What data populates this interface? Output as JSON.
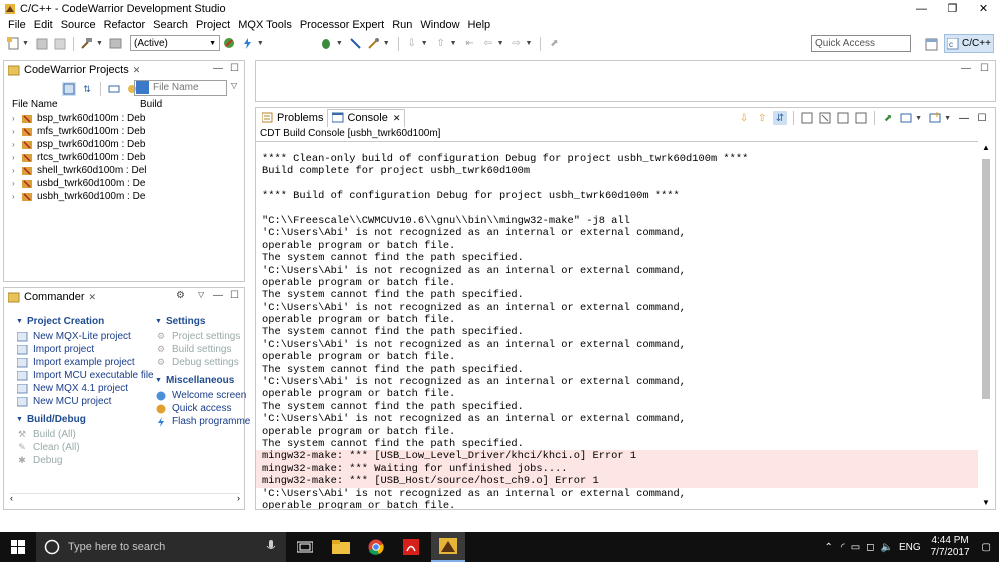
{
  "window": {
    "title": "C/C++ - CodeWarrior Development Studio",
    "minimize_glyph": "—",
    "maximize_glyph": "❐",
    "close_glyph": "✕"
  },
  "menubar": [
    "File",
    "Edit",
    "Source",
    "Refactor",
    "Search",
    "Project",
    "MQX Tools",
    "Processor Expert",
    "Run",
    "Window",
    "Help"
  ],
  "toolbar": {
    "config_value": "(Active)",
    "quick_access_placeholder": "Quick Access",
    "perspective_label": "C/C++"
  },
  "projects_view": {
    "tab_label": "CodeWarrior Projects",
    "filter_placeholder": "File Name",
    "col_file_name": "File Name",
    "col_build": "Build",
    "items": [
      {
        "label": "bsp_twrk60d100m : Deb"
      },
      {
        "label": "mfs_twrk60d100m : Deb"
      },
      {
        "label": "psp_twrk60d100m : Deb"
      },
      {
        "label": "rtcs_twrk60d100m : Deb"
      },
      {
        "label": "shell_twrk60d100m : Del"
      },
      {
        "label": "usbd_twrk60d100m : De"
      },
      {
        "label": "usbh_twrk60d100m : De"
      }
    ]
  },
  "commander": {
    "tab_label": "Commander",
    "project_creation": {
      "header": "Project Creation",
      "items": [
        "New MQX-Lite project",
        "Import project",
        "Import example project",
        "Import MCU executable file",
        "New MQX 4.1 project",
        "New MCU project"
      ]
    },
    "build_debug": {
      "header": "Build/Debug",
      "items": [
        "Build  (All)",
        "Clean  (All)",
        "Debug"
      ]
    },
    "settings": {
      "header": "Settings",
      "items": [
        "Project settings",
        "Build settings",
        "Debug settings"
      ]
    },
    "miscellaneous": {
      "header": "Miscellaneous",
      "items": [
        "Welcome screen",
        "Quick access",
        "Flash programme"
      ]
    }
  },
  "console_view": {
    "tab_problems": "Problems",
    "tab_console": "Console",
    "title": "CDT Build Console [usbh_twrk60d100m]",
    "lines": [
      {
        "text": "**** Clean-only build of configuration Debug for project usbh_twrk60d100m ****",
        "error": false
      },
      {
        "text": "Build complete for project usbh_twrk60d100m",
        "error": false
      },
      {
        "text": "",
        "error": false
      },
      {
        "text": "**** Build of configuration Debug for project usbh_twrk60d100m ****",
        "error": false
      },
      {
        "text": "",
        "error": false
      },
      {
        "text": "\"C:\\\\Freescale\\\\CWMCUv10.6\\\\gnu\\\\bin\\\\mingw32-make\" -j8 all",
        "error": false
      },
      {
        "text": "'C:\\Users\\Abi' is not recognized as an internal or external command,",
        "error": false
      },
      {
        "text": "operable program or batch file.",
        "error": false
      },
      {
        "text": "The system cannot find the path specified.",
        "error": false
      },
      {
        "text": "'C:\\Users\\Abi' is not recognized as an internal or external command,",
        "error": false
      },
      {
        "text": "operable program or batch file.",
        "error": false
      },
      {
        "text": "The system cannot find the path specified.",
        "error": false
      },
      {
        "text": "'C:\\Users\\Abi' is not recognized as an internal or external command,",
        "error": false
      },
      {
        "text": "operable program or batch file.",
        "error": false
      },
      {
        "text": "The system cannot find the path specified.",
        "error": false
      },
      {
        "text": "'C:\\Users\\Abi' is not recognized as an internal or external command,",
        "error": false
      },
      {
        "text": "operable program or batch file.",
        "error": false
      },
      {
        "text": "The system cannot find the path specified.",
        "error": false
      },
      {
        "text": "'C:\\Users\\Abi' is not recognized as an internal or external command,",
        "error": false
      },
      {
        "text": "operable program or batch file.",
        "error": false
      },
      {
        "text": "The system cannot find the path specified.",
        "error": false
      },
      {
        "text": "'C:\\Users\\Abi' is not recognized as an internal or external command,",
        "error": false
      },
      {
        "text": "operable program or batch file.",
        "error": false
      },
      {
        "text": "The system cannot find the path specified.",
        "error": false
      },
      {
        "text": "mingw32-make: *** [USB_Low_Level_Driver/khci/khci.o] Error 1",
        "error": true
      },
      {
        "text": "mingw32-make: *** Waiting for unfinished jobs....",
        "error": true
      },
      {
        "text": "mingw32-make: *** [USB_Host/source/host_ch9.o] Error 1",
        "error": true
      },
      {
        "text": "'C:\\Users\\Abi' is not recognized as an internal or external command,",
        "error": false
      },
      {
        "text": "operable program or batch file.",
        "error": false
      }
    ]
  },
  "taskbar": {
    "search_placeholder": "Type here to search",
    "language": "ENG",
    "time": "4:44 PM",
    "date": "7/7/2017"
  },
  "colors": {
    "link": "#1a3d8a",
    "error_bg": "#fde5e4",
    "taskbar_bg": "#101010"
  }
}
